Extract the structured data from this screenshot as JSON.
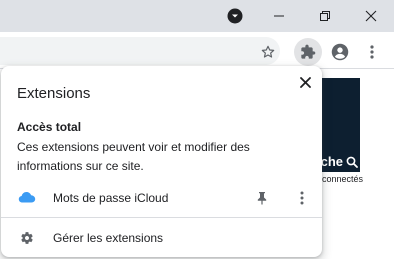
{
  "window": {
    "controls": [
      "minimize",
      "restore",
      "close"
    ]
  },
  "toolbar": {
    "icons": [
      "star-icon",
      "puzzle-icon",
      "profile-icon",
      "menu-icon"
    ]
  },
  "page_behind": {
    "dark_text": "che",
    "small_text": "connectés"
  },
  "popup": {
    "title": "Extensions",
    "section_heading": "Accès total",
    "section_description": "Ces extensions peuvent voir et modifier des informations sur ce site.",
    "extensions": [
      {
        "name": "Mots de passe iCloud",
        "icon": "icloud-icon"
      }
    ],
    "manage_label": "Gérer les extensions"
  },
  "colors": {
    "titlebar": "#dee1e6",
    "omnibox": "#f1f3f4",
    "icloud_blue": "#3b9bf3",
    "page_dark": "#0d1f30"
  }
}
